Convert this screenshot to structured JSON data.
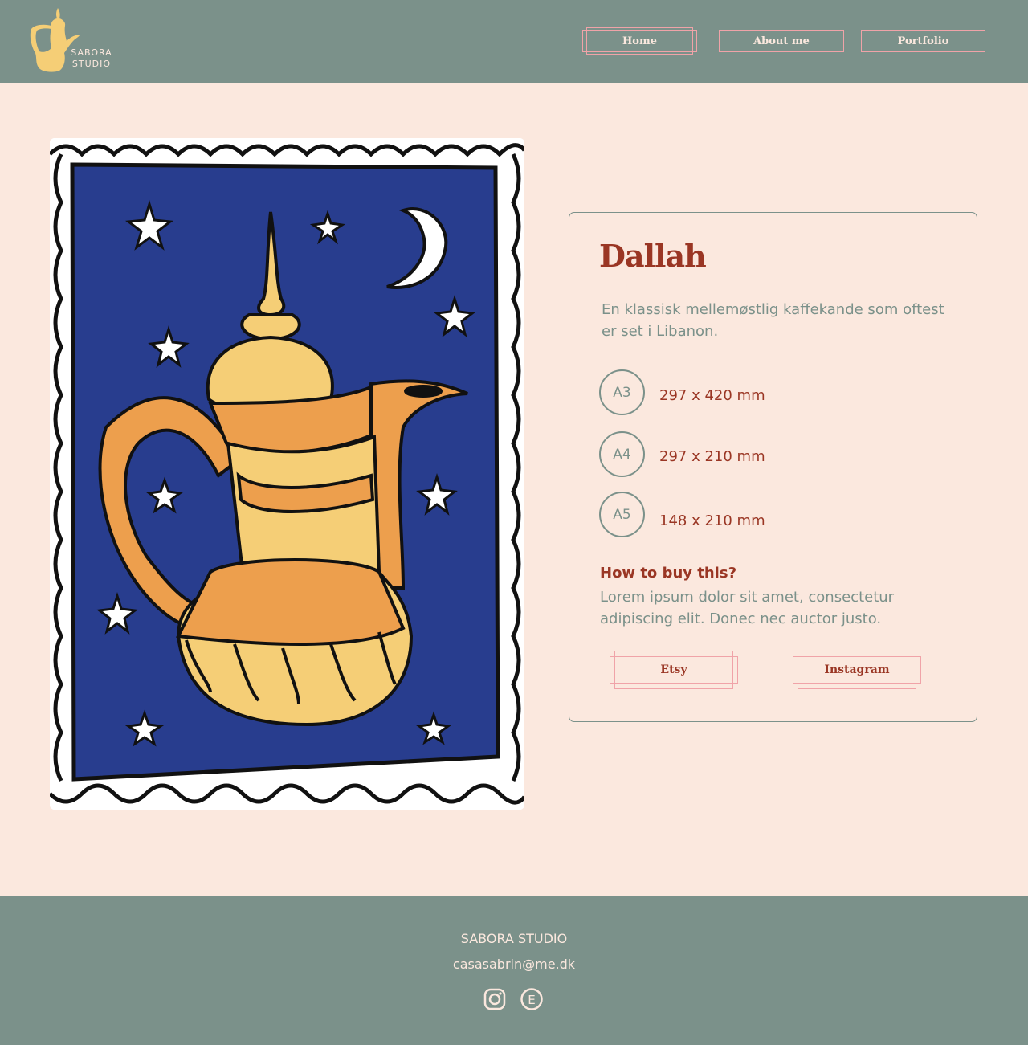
{
  "brand": {
    "line1": "SABORA",
    "line2": "STUDIO"
  },
  "nav": {
    "home": "Home",
    "about": "About me",
    "portfolio": "Portfolio"
  },
  "product": {
    "title": "Dallah",
    "description": "En klassisk mellemøstlig kaffekande som oftest er set i Libanon.",
    "sizes": [
      {
        "label": "A3",
        "dims": "297 x 420 mm"
      },
      {
        "label": "A4",
        "dims": "297 x 210 mm"
      },
      {
        "label": "A5",
        "dims": "148 x 210 mm"
      }
    ],
    "buy_title": "How to buy this?",
    "buy_text": "Lorem ipsum dolor sit amet, consectetur adipiscing elit. Donec nec auctor justo.",
    "etsy_label": "Etsy",
    "instagram_label": "Instagram"
  },
  "footer": {
    "name": "SABORA STUDIO",
    "email": "casasabrin@me.dk",
    "etsy_glyph": "E"
  },
  "colors": {
    "header": "#7b918a",
    "background": "#fbe8de",
    "accent": "#9a3624",
    "button_border": "#f0a3a8",
    "poster_blue": "#283d8e",
    "pot_yellow": "#f5ce76",
    "pot_orange": "#ed9f4d"
  },
  "icons": [
    "dallah-logo-icon",
    "instagram-icon",
    "etsy-icon",
    "moon-icon",
    "star-icon"
  ]
}
